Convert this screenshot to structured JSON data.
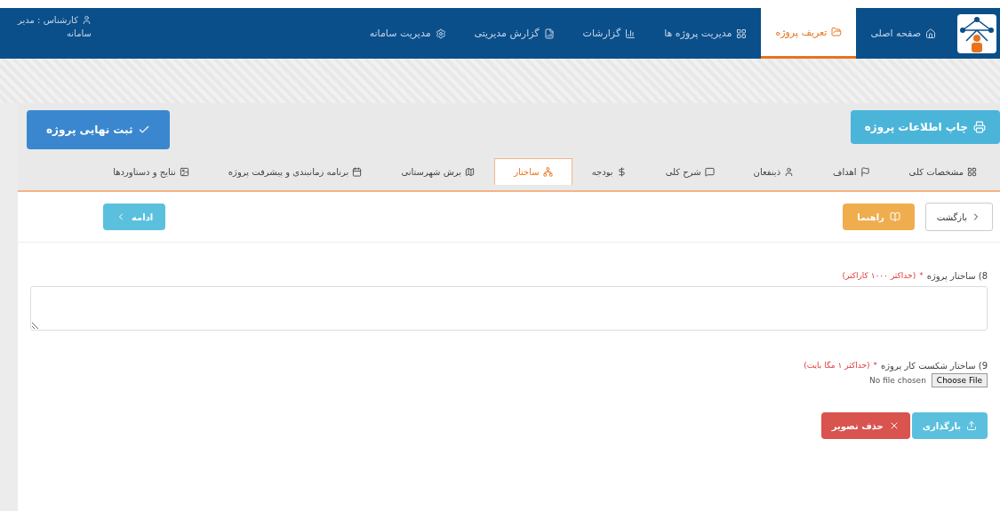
{
  "navbar": {
    "items": [
      {
        "label": "صفحه اصلی",
        "selected": false
      },
      {
        "label": "تعریف پروژه",
        "selected": true
      },
      {
        "label": "مدیریت پروژه ها",
        "selected": false
      },
      {
        "label": "گزارشات",
        "selected": false
      },
      {
        "label": "گزارش مدیریتی",
        "selected": false
      },
      {
        "label": "مدیریت سامانه",
        "selected": false
      }
    ],
    "user": {
      "label": "کارشناس : مدیر",
      "sublabel": "سامانه"
    }
  },
  "toolbar": {
    "print_button": "چاپ اطلاعات پروژه",
    "submit_button": "ثبت نهایی پروژه"
  },
  "tabs": [
    {
      "label": "مشخصات کلی",
      "selected": false
    },
    {
      "label": "اهداف",
      "selected": false
    },
    {
      "label": "ذینفعان",
      "selected": false
    },
    {
      "label": "شرح کلی",
      "selected": false
    },
    {
      "label": "بودجه",
      "selected": false
    },
    {
      "label": "ساختار",
      "selected": true
    },
    {
      "label": "برش شهرستانی",
      "selected": false
    },
    {
      "label": "برنامه زمانبندی و پیشرفت پروژه",
      "selected": false
    },
    {
      "label": "نتایج و دستاوردها",
      "selected": false
    }
  ],
  "actions": {
    "back": "بازگشت",
    "help": "راهنما",
    "next": "ادامه"
  },
  "form": {
    "structure_label": "8) ساختار پروژه",
    "structure_required": "*",
    "structure_hint": "(حداکثر ۱۰۰۰ کاراکتر)",
    "wbs_label": "9) ساختار شکست کار پروژه",
    "wbs_required": "*",
    "wbs_hint": "(حداکثر ۱ مگا بایت)",
    "file_status": "No file chosen",
    "file_button": "Choose File",
    "upload_button": "بارگذاری",
    "delete_button": "حذف تصویر"
  }
}
